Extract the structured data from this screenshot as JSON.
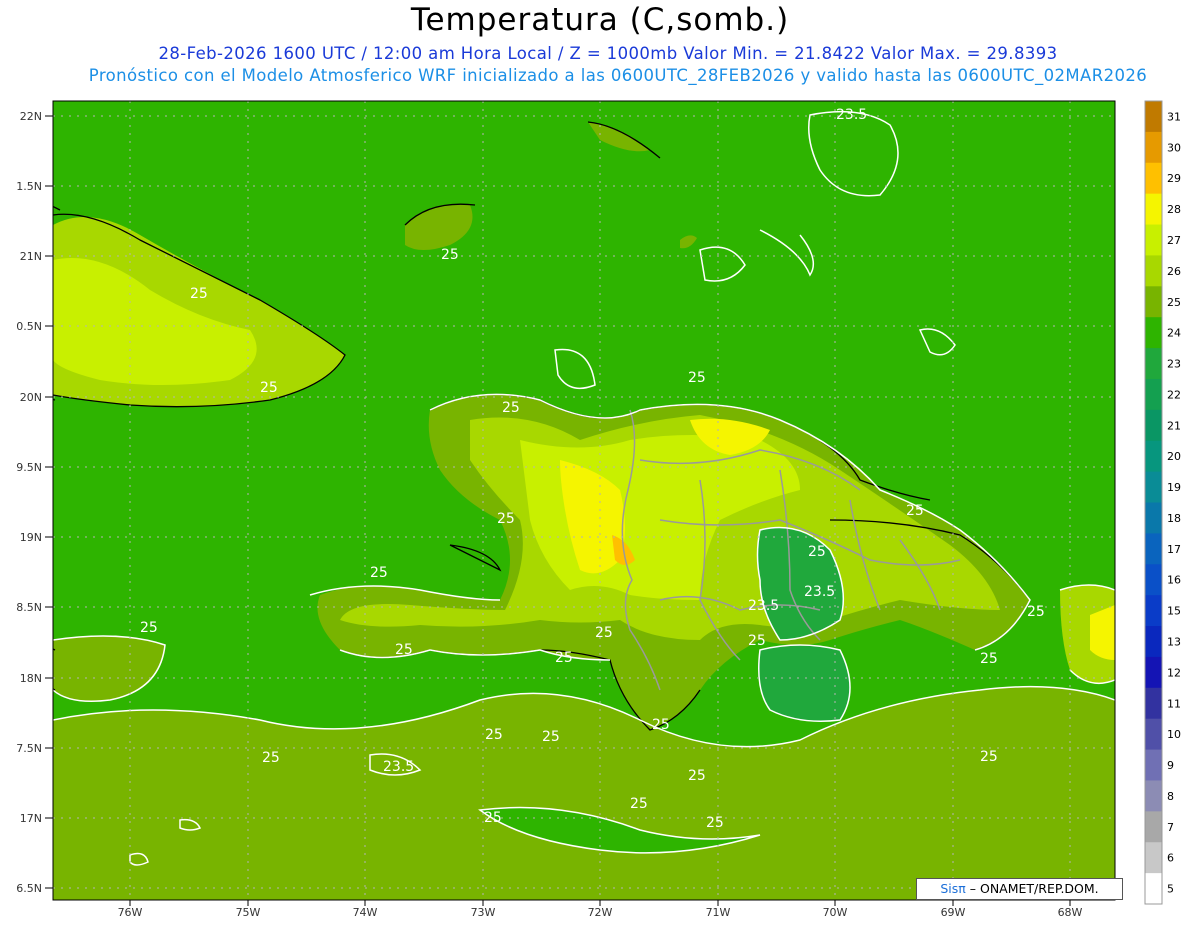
{
  "header": {
    "title": "Temperatura (C,somb.)",
    "subtitle_1": "28-Feb-2026 1600 UTC / 12:00 am Hora Local / Z = 1000mb   Valor Min. = 21.8422  Valor Max. = 29.8393",
    "subtitle_2": "Pronóstico con el Modelo Atmosferico WRF inicializado a las 0600UTC_28FEB2026 y valido hasta las  0600UTC_02MAR2026"
  },
  "axes": {
    "lat_labels": [
      "22N",
      "1.5N",
      "21N",
      "0.5N",
      "20N",
      "9.5N",
      "19N",
      "8.5N",
      "18N",
      "7.5N",
      "17N",
      "6.5N"
    ],
    "lon_labels": [
      "76W",
      "75W",
      "74W",
      "73W",
      "72W",
      "71W",
      "70W",
      "69W",
      "68W"
    ]
  },
  "colorbar": {
    "labels": [
      "31",
      "30",
      "29",
      "28",
      "27",
      "26",
      "25",
      "24",
      "23",
      "22",
      "21",
      "20",
      "19",
      "18",
      "17",
      "16",
      "15",
      "13",
      "12",
      "11",
      "10",
      "9",
      "8",
      "7",
      "6",
      "5"
    ],
    "colors": [
      "#c07a00",
      "#e69a00",
      "#ffc000",
      "#f5f500",
      "#c8f000",
      "#a8d800",
      "#78b400",
      "#2eb400",
      "#20a83c",
      "#14a050",
      "#0a9664",
      "#07967e",
      "#0a8c96",
      "#0a78aa",
      "#0a64be",
      "#0a50c8",
      "#0a3cc8",
      "#0a28be",
      "#1414b4",
      "#3232a0",
      "#5050a8",
      "#7070b4",
      "#8c8cb4",
      "#a8a8a8",
      "#c8c8c8",
      "#ffffff"
    ]
  },
  "contour_labels": [
    "23.5",
    "25",
    "25",
    "25",
    "25",
    "25",
    "25",
    "25",
    "25",
    "25",
    "25",
    "25",
    "25",
    "25",
    "25",
    "23.5",
    "23.5",
    "25",
    "25",
    "25",
    "25",
    "25",
    "25",
    "25",
    "25",
    "25",
    "23.5",
    "25",
    "25"
  ],
  "branding": {
    "logo_text": "Sisπ",
    "org_text": " – ONAMET/REP.DOM."
  },
  "colors": {
    "background_field": "#2eb400",
    "band_25_26": "#78b400",
    "band_26_27": "#a8d800",
    "band_27_28": "#c8f000",
    "band_28_29": "#f5f500",
    "band_29_30": "#ffc000",
    "band_23_24": "#20a83c"
  }
}
